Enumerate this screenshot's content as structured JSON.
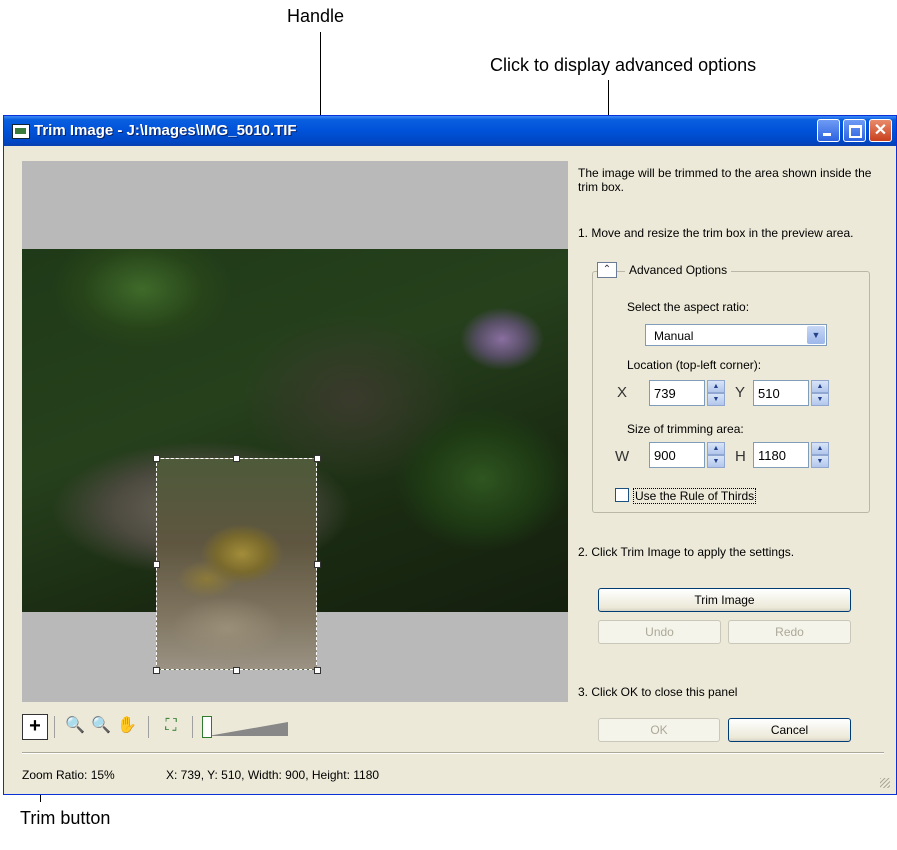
{
  "callouts": {
    "handle": "Handle",
    "advanced": "Click to display advanced options",
    "trim_button": "Trim button"
  },
  "window": {
    "title": "Trim Image - J:\\Images\\IMG_5010.TIF",
    "close_glyph": "✕"
  },
  "panel": {
    "intro": "The image will be trimmed to the area shown inside the trim box.",
    "step1": "1.  Move and resize the trim box in the preview area.",
    "advanced_title": "Advanced Options",
    "advanced_toggle": "⌃",
    "aspect_label": "Select the aspect ratio:",
    "aspect_value": "Manual",
    "location_label": "Location (top-left corner):",
    "x_label": "X",
    "x_value": "739",
    "y_label": "Y",
    "y_value": "510",
    "size_label": "Size of trimming area:",
    "w_label": "W",
    "w_value": "900",
    "h_label": "H",
    "h_value": "1180",
    "rule_of_thirds": "Use the Rule of Thirds",
    "rule_of_thirds_checked": false,
    "step2": "2. Click Trim Image to apply the settings.",
    "trim_image": "Trim Image",
    "undo": "Undo",
    "redo": "Redo",
    "step3": "3. Click OK to close this panel",
    "ok": "OK",
    "cancel": "Cancel"
  },
  "toolbar": {
    "trim_icon": "+",
    "zoom_in_icon": "🔍",
    "zoom_out_icon": "🔍",
    "hand_icon": "✋",
    "fit_icon": "⛶"
  },
  "status": {
    "zoom": "Zoom Ratio: 15%",
    "coords": "X: 739, Y: 510, Width: 900, Height: 1180"
  }
}
